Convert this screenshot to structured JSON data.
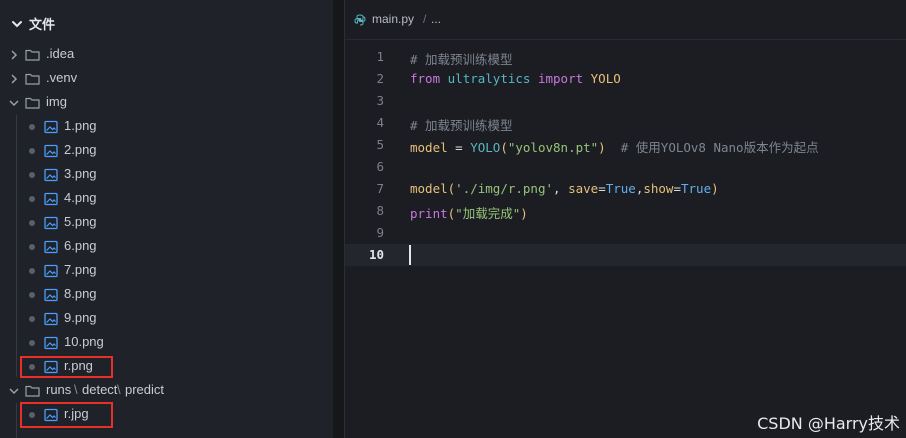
{
  "sidebar": {
    "header": {
      "title": "文件"
    },
    "items": [
      {
        "label": ".idea",
        "kind": "folder",
        "expanded": false
      },
      {
        "label": ".venv",
        "kind": "folder",
        "expanded": false
      },
      {
        "label": "img",
        "kind": "folder",
        "expanded": true
      },
      {
        "label": "1.png",
        "kind": "image"
      },
      {
        "label": "2.png",
        "kind": "image"
      },
      {
        "label": "3.png",
        "kind": "image"
      },
      {
        "label": "4.png",
        "kind": "image"
      },
      {
        "label": "5.png",
        "kind": "image"
      },
      {
        "label": "6.png",
        "kind": "image"
      },
      {
        "label": "7.png",
        "kind": "image"
      },
      {
        "label": "8.png",
        "kind": "image"
      },
      {
        "label": "9.png",
        "kind": "image"
      },
      {
        "label": "10.png",
        "kind": "image"
      },
      {
        "label": "r.png",
        "kind": "image",
        "highlighted": true
      },
      {
        "label": "runs",
        "kind": "folder",
        "expanded": true,
        "path_parts": [
          "runs",
          "detect",
          "predict"
        ]
      },
      {
        "label": "r.jpg",
        "kind": "image",
        "highlighted": true
      }
    ]
  },
  "editor": {
    "breadcrumb": {
      "file": "main.py",
      "separator": "/",
      "more": "..."
    },
    "current_line": 10,
    "lines": [
      {
        "no": "1",
        "text": "# 加载预训练模型"
      },
      {
        "no": "2",
        "text": "from ultralytics import YOLO"
      },
      {
        "no": "3",
        "text": ""
      },
      {
        "no": "4",
        "text": "# 加载预训练模型"
      },
      {
        "no": "5",
        "text": "model = YOLO(\"yolov8n.pt\")  # 使用YOLOv8 Nano版本作为起点"
      },
      {
        "no": "6",
        "text": ""
      },
      {
        "no": "7",
        "text": "model('./img/r.png', save=True,show=True)"
      },
      {
        "no": "8",
        "text": "print(\"加载完成\")"
      },
      {
        "no": "9",
        "text": ""
      },
      {
        "no": "10",
        "text": ""
      }
    ],
    "tokens": {
      "l1": "# 加载预训练模型",
      "l2_from": "from",
      "l2_mod": "ultralytics",
      "l2_import": "import",
      "l2_name": "YOLO",
      "l4": "# 加载预训练模型",
      "l5_var": "model",
      "l5_eq": " = ",
      "l5_call": "YOLO",
      "l5_open": "(",
      "l5_str": "\"yolov8n.pt\"",
      "l5_close": ")",
      "l5_comment": "  # 使用YOLOv8 Nano版本作为起点",
      "l7_call": "model",
      "l7_open": "(",
      "l7_str": "'./img/r.png'",
      "l7_sep1": ", ",
      "l7_arg1": "save",
      "l7_eq1": "=",
      "l7_val1": "True",
      "l7_sep2": ",",
      "l7_arg2": "show",
      "l7_eq2": "=",
      "l7_val2": "True",
      "l7_close": ")",
      "l8_fn": "print",
      "l8_open": "(",
      "l8_str": "\"加载完成\"",
      "l8_close": ")"
    }
  },
  "watermark": "CSDN @Harry技术",
  "colors": {
    "highlight_box": "#e8302a",
    "image_icon": "#4a9eff",
    "folder_icon": "#9aa0aa"
  }
}
